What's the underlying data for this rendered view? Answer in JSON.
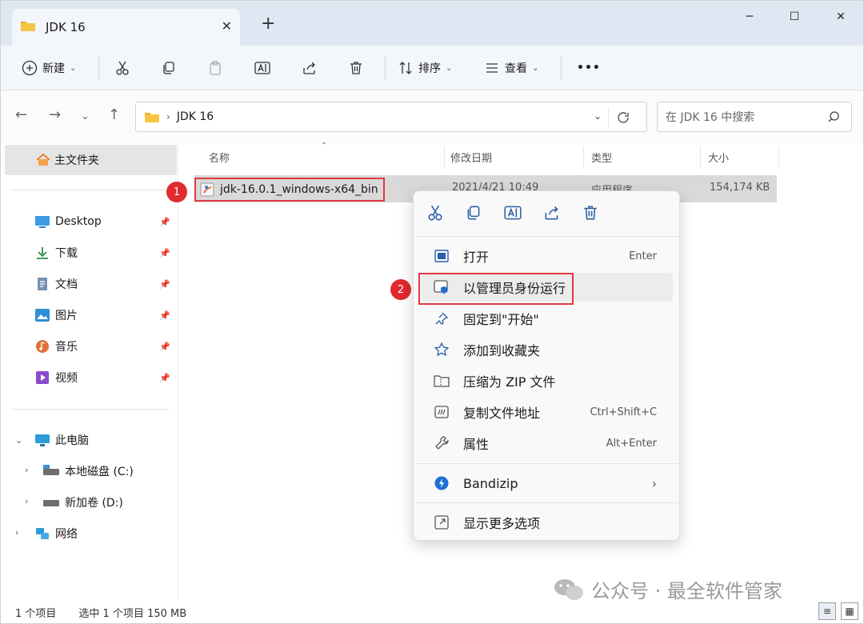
{
  "window": {
    "tab_title": "JDK 16",
    "tab_close": "✕",
    "new_tab": "+",
    "minimize": "─",
    "maximize": "☐",
    "close": "✕"
  },
  "toolbar": {
    "new_label": "新建",
    "sort_label": "排序",
    "view_label": "查看",
    "more_label": "•••"
  },
  "address": {
    "path_segment": "JDK 16",
    "search_placeholder": "在 JDK 16 中搜索"
  },
  "sidebar": {
    "home": "主文件夹",
    "pinned": [
      {
        "label": "Desktop",
        "icon": "desktop-icon"
      },
      {
        "label": "下载",
        "icon": "download-icon"
      },
      {
        "label": "文档",
        "icon": "documents-icon"
      },
      {
        "label": "图片",
        "icon": "pictures-icon"
      },
      {
        "label": "音乐",
        "icon": "music-icon"
      },
      {
        "label": "视频",
        "icon": "videos-icon"
      }
    ],
    "this_pc": "此电脑",
    "drives": [
      {
        "label": "本地磁盘 (C:)"
      },
      {
        "label": "新加卷 (D:)"
      }
    ],
    "network": "网络"
  },
  "columns": {
    "name": "名称",
    "modified": "修改日期",
    "type": "类型",
    "size": "大小"
  },
  "file": {
    "name": "jdk-16.0.1_windows-x64_bin",
    "modified": "2021/4/21 10:49",
    "type": "应用程序",
    "size": "154,174 KB"
  },
  "badges": {
    "one": "1",
    "two": "2"
  },
  "context_menu": {
    "items": [
      {
        "label": "打开",
        "shortcut": "Enter"
      },
      {
        "label": "以管理员身份运行",
        "shortcut": ""
      },
      {
        "label": "固定到\"开始\"",
        "shortcut": ""
      },
      {
        "label": "添加到收藏夹",
        "shortcut": ""
      },
      {
        "label": "压缩为 ZIP 文件",
        "shortcut": ""
      },
      {
        "label": "复制文件地址",
        "shortcut": "Ctrl+Shift+C"
      },
      {
        "label": "属性",
        "shortcut": "Alt+Enter"
      },
      {
        "label": "Bandizip",
        "shortcut": "›"
      },
      {
        "label": "显示更多选项",
        "shortcut": ""
      }
    ]
  },
  "status": {
    "count": "1 个项目",
    "selected": "选中 1 个项目  150 MB"
  },
  "watermark": "公众号 · 最全软件管家",
  "colors": {
    "accent": "#0067c0",
    "highlight_red": "#e0393e",
    "badge_red": "#e02a2f",
    "folder_yellow": "#f6c443"
  }
}
